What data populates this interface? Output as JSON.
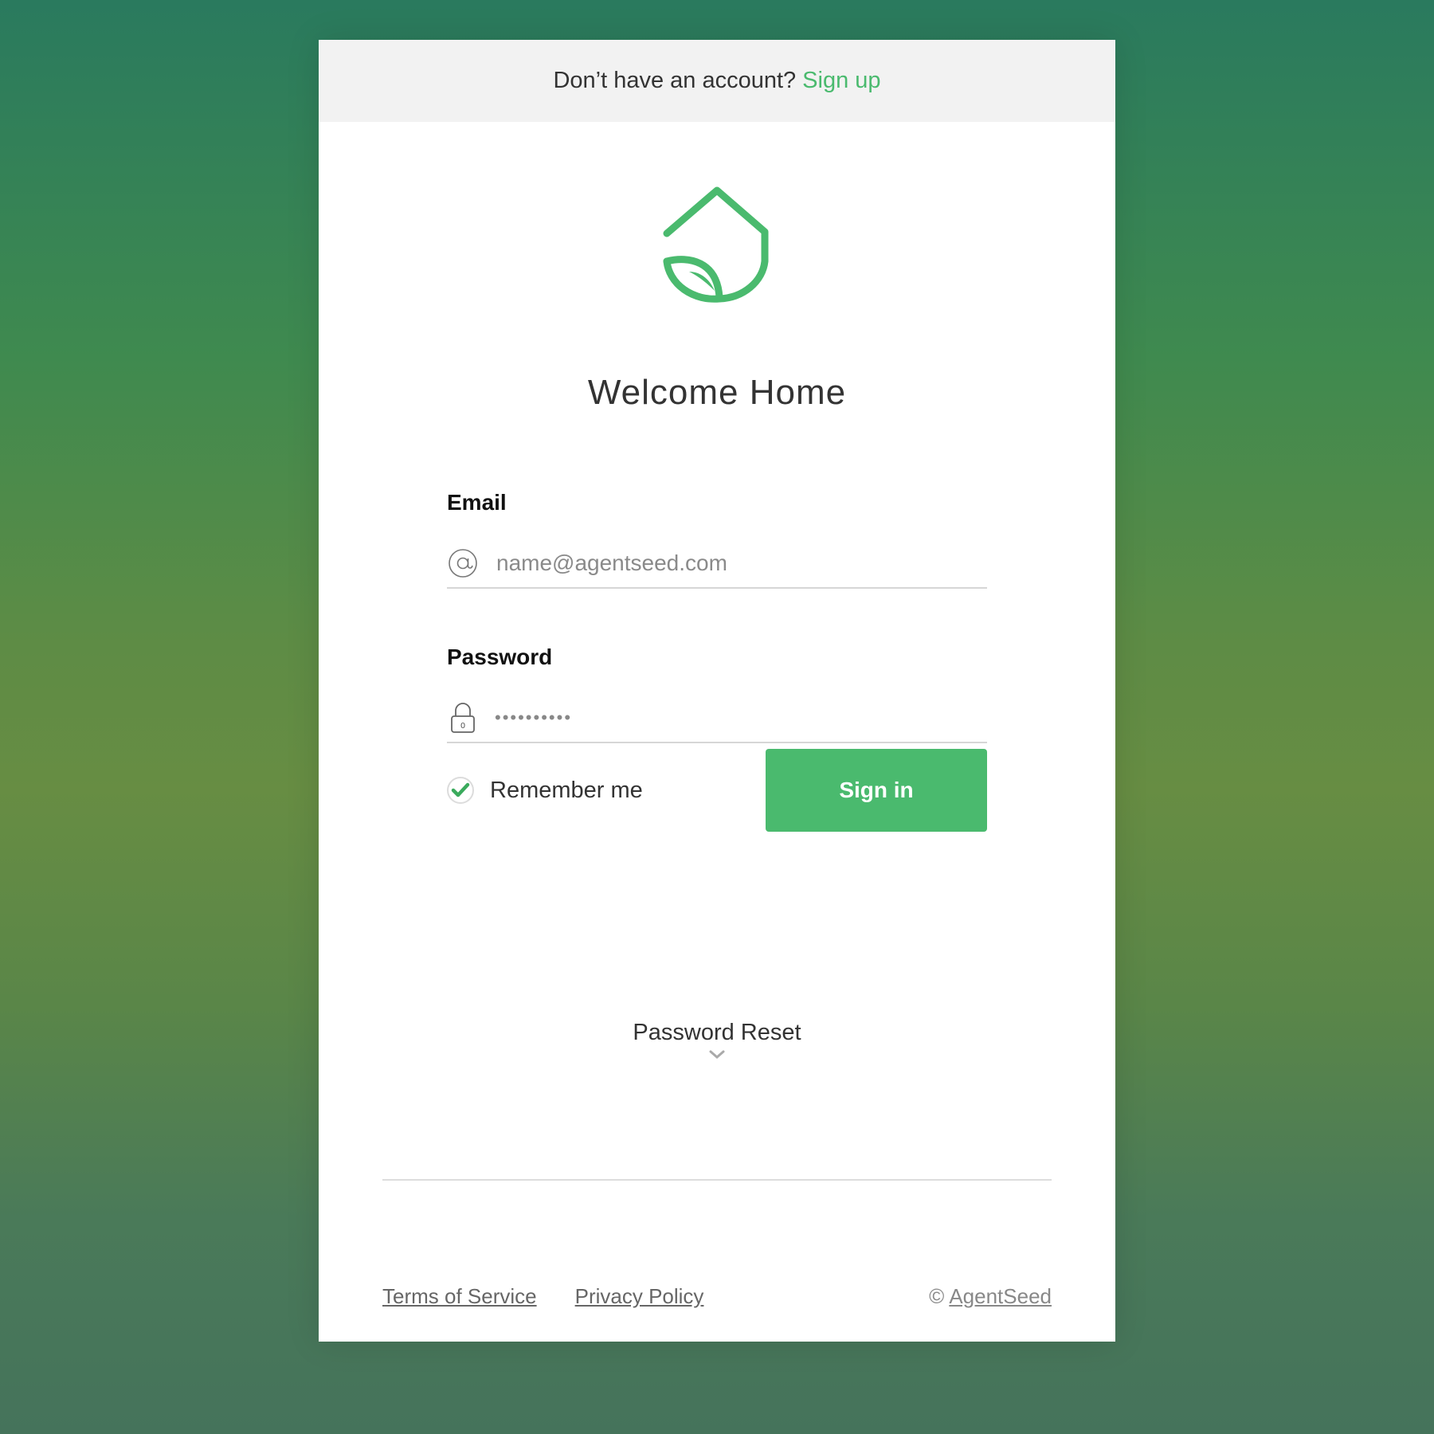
{
  "signup_bar": {
    "prompt": "Don’t have an account?",
    "link_label": "Sign up"
  },
  "logo": {
    "icon": "house-leaf-logo-icon",
    "color": "#4aba6e"
  },
  "title": "Welcome Home",
  "email": {
    "label": "Email",
    "icon": "at-sign-icon",
    "value": "",
    "placeholder": "name@agentseed.com"
  },
  "password": {
    "label": "Password",
    "icon": "lock-icon",
    "masked_value": "••••••••••"
  },
  "remember_me": {
    "label": "Remember me",
    "checked": true
  },
  "signin_button": {
    "label": "Sign in"
  },
  "password_reset": {
    "label": "Password Reset",
    "icon": "chevron-down-icon"
  },
  "footer": {
    "terms": "Terms of Service",
    "privacy": "Privacy Policy",
    "copyright_symbol": "©",
    "brand": "AgentSeed"
  },
  "colors": {
    "accent": "#4aba6e",
    "header_bg": "#f2f2f2",
    "text": "#333333"
  }
}
